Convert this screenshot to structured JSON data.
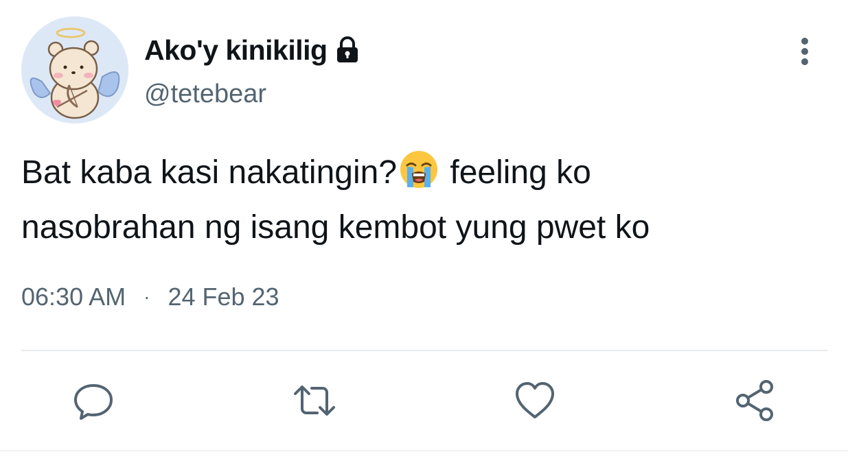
{
  "user": {
    "display_name": "Ako'y kinikilig",
    "handle": "@tetebear",
    "avatar": "angel-bear-avatar",
    "protected": true
  },
  "tweet": {
    "text_part1": "Bat kaba kasi nakatingin?",
    "emoji": "loudly-crying-face",
    "text_part2": " feeling ko",
    "text_line2": "nasobrahan ng isang kembot yung pwet ko",
    "time": "06:30 AM",
    "separator": "·",
    "date": "24 Feb 23"
  },
  "actions": {
    "reply": "comment-icon",
    "retweet": "retweet-icon",
    "like": "heart-icon",
    "share": "share-icon"
  },
  "colors": {
    "text": "#0f1419",
    "secondary": "#536471",
    "divider": "#e7eaed"
  }
}
